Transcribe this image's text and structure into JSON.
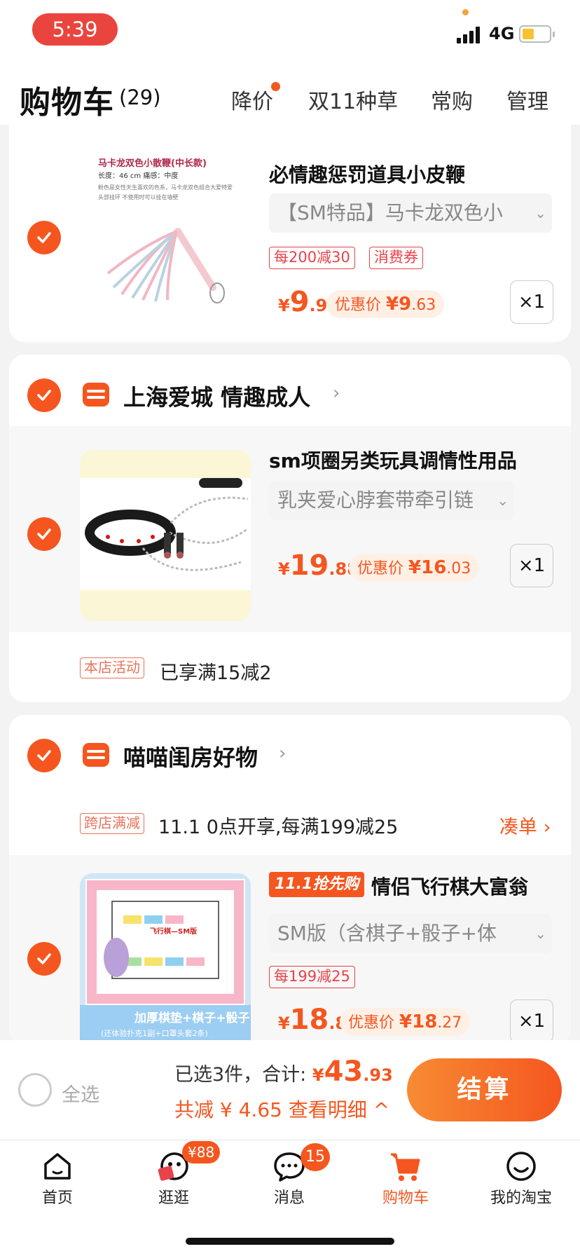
{
  "status_bar": {
    "time": "5:39",
    "network": "4G"
  },
  "header": {
    "title": "购物车",
    "count": "(29)",
    "tabs": [
      {
        "label": "降价",
        "dot": true
      },
      {
        "label": "双11种草"
      },
      {
        "label": "常购"
      },
      {
        "label": "管理"
      }
    ]
  },
  "items": [
    {
      "thumb_title": "马卡龙双色小散鞭(中长款)",
      "thumb_spec": "长度：46 cm    痛感：中度",
      "thumb_desc1": "粉色是女性天生喜欢的色系，马卡龙双色组合大爱特爱",
      "thumb_desc2": "头部挂环 不使用时可以挂在墙壁",
      "name": "必情趣惩罚道具小皮鞭",
      "sku": "【SM特品】马卡龙双色小",
      "tags": [
        "每200减30",
        "消费券"
      ],
      "price_currency": "¥",
      "price_int": "9",
      "price_dec": ".9",
      "promo_label": "优惠价",
      "promo_price": "¥9",
      "promo_dec": ".63",
      "qty": "×1"
    },
    {
      "name": "sm项圈另类玩具调情性用品",
      "sku": "乳夹爱心脖套带牵引链",
      "price_currency": "¥",
      "price_int": "19",
      "price_dec": ".88",
      "promo_label": "优惠价",
      "promo_price": "¥16",
      "promo_dec": ".03",
      "qty": "×1"
    },
    {
      "badge": "11.1抢先购",
      "name": "情侣飞行棋大富翁",
      "sku": "SM版（含棋子+骰子+体",
      "tags": [
        "每199减25"
      ],
      "board_title": "飞行棋—SM版",
      "board_banner": "加厚棋垫+棋子+骰子",
      "board_sub": "(还体验扑克1副+口罩头套2条)",
      "price_currency": "¥",
      "price_int": "18",
      "price_dec": ".8",
      "promo_label": "优惠价",
      "promo_price": "¥18",
      "promo_dec": ".27",
      "qty": "×1"
    }
  ],
  "shops": [
    {
      "name": "上海爱城 情趣成人",
      "activity_tag": "本店活动",
      "activity_text": "已享满15减2"
    },
    {
      "name": "喵喵闺房好物",
      "activity_tag": "跨店满减",
      "activity_text": "11.1 0点开享,每满199减25",
      "activity_action": "凑单 ›"
    }
  ],
  "checkout": {
    "select_all": "全选",
    "selected_text": "已选3件，合计:",
    "total_currency": "¥",
    "total_int": "43",
    "total_dec": ".93",
    "savings": "共减 ¥ 4.65  查看明细 ^",
    "button": "结算"
  },
  "tab_bar": [
    {
      "label": "首页",
      "icon": "home-icon"
    },
    {
      "label": "逛逛",
      "icon": "browse-icon",
      "badge": "¥88"
    },
    {
      "label": "消息",
      "icon": "message-icon",
      "badge": "15"
    },
    {
      "label": "购物车",
      "icon": "cart-icon",
      "active": true
    },
    {
      "label": "我的淘宝",
      "icon": "smile-icon"
    }
  ],
  "colors": {
    "accent": "#f5561f",
    "status_pill": "#e9453e",
    "tag_red": "#e8424a"
  }
}
